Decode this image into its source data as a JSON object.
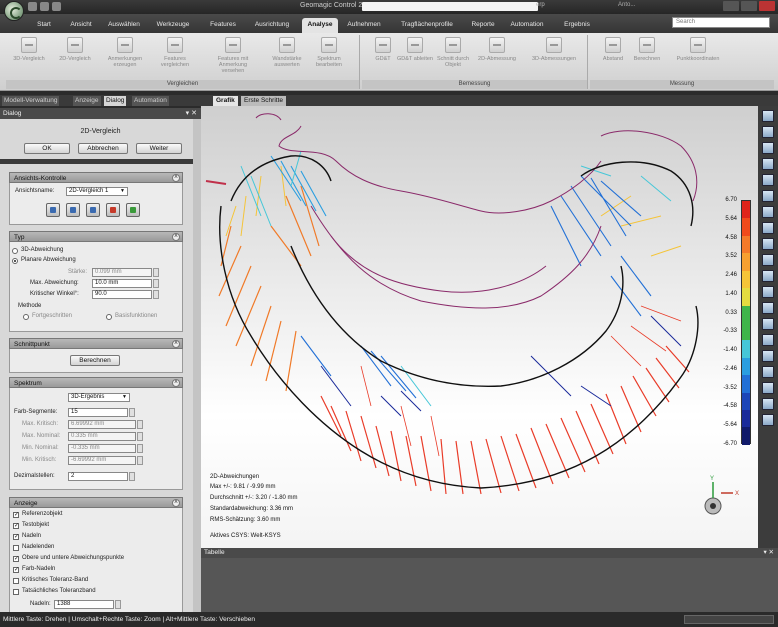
{
  "window": {
    "title": "Geomagic Control 2014",
    "title_path_tail": "erp",
    "user": "Anto..."
  },
  "ribbon_tabs": [
    "Start",
    "Ansicht",
    "Auswählen",
    "Werkzeuge",
    "Features",
    "Ausrichtung",
    "Analyse",
    "Aufnehmen",
    "Tragflächenprofile",
    "Reporte",
    "Automation",
    "Ergebnis"
  ],
  "search_placeholder": "Search",
  "ribbon_groups": {
    "vergleichen": {
      "label": "Vergleichen",
      "buttons": [
        "3D-Vergleich",
        "2D-Vergleich",
        "Anmerkungen erzeugen",
        "Features vergleichen",
        "Features mit Anmerkung versehen",
        "Wandstärke auswerten",
        "Spektrum bearbeiten"
      ]
    },
    "bemessung": {
      "label": "Bemessung",
      "buttons": [
        "GD&T",
        "GD&T ableiten",
        "Schnitt durch Objekt",
        "2D-Abmessung",
        "3D-Abmessungen"
      ]
    },
    "messung": {
      "label": "Messung",
      "buttons": [
        "Abstand",
        "Berechnen",
        "Punktkoordinaten"
      ]
    }
  },
  "panel_tabs": [
    "Modell-Verwaltung",
    "Anzeige",
    "Dialog",
    "Automation"
  ],
  "dialog": {
    "header": "Dialog",
    "title": "2D-Vergleich",
    "ok": "OK",
    "cancel": "Abbrechen",
    "next": "Weiter",
    "ansichts_kontrolle": {
      "header": "Ansichts-Kontrolle",
      "ansichtsname_label": "Ansichtsname:",
      "ansichtsname_value": "2D-Vergleich 1"
    },
    "typ": {
      "header": "Typ",
      "option_3d": "3D-Abweichung",
      "option_planar": "Planare Abweichung",
      "staerke_label": "Stärke:",
      "staerke_value": "0.099 mm",
      "max_abw_label": "Max. Abweichung:",
      "max_abw_value": "10.0 mm",
      "winkel_label": "Kritischer Winkel°:",
      "winkel_value": "90.0",
      "methode_label": "Methode",
      "methode_opt1": "Fortgeschritten",
      "methode_opt2": "Basisfunktionen"
    },
    "schnittpunkt": {
      "header": "Schnittpunkt",
      "button": "Berechnen"
    },
    "spektrum": {
      "header": "Spektrum",
      "mode": "3D-Ergebnis",
      "farb_label": "Farb-Segmente:",
      "farb_value": "15",
      "max_krit_label": "Max. Kritisch:",
      "max_krit_value": "6.69992 mm",
      "max_nom_label": "Max. Nominal:",
      "max_nom_value": "0.335 mm",
      "min_nom_label": "Min. Nominal:",
      "min_nom_value": "-0.335 mm",
      "min_krit_label": "Min. Kritisch:",
      "min_krit_value": "-6.69992 mm",
      "dezimal_label": "Dezimalstellen:",
      "dezimal_value": "2"
    },
    "anzeige": {
      "header": "Anzeige",
      "items": [
        {
          "label": "Referenzobjekt",
          "checked": true
        },
        {
          "label": "Testobjekt",
          "checked": true
        },
        {
          "label": "Nadeln",
          "checked": true
        },
        {
          "label": "Nadelenden",
          "checked": false
        },
        {
          "label": "Obere und untere Abweichungspunkte",
          "checked": true
        },
        {
          "label": "Farb-Nadeln",
          "checked": true
        },
        {
          "label": "Kritisches Toleranz-Band",
          "checked": false
        },
        {
          "label": "Tatsächliches Toleranzband",
          "checked": false
        }
      ],
      "nadeln_label": "Nadeln:",
      "nadeln_value": "1388"
    }
  },
  "view_tabs": [
    "Grafik",
    "Erste Schritte"
  ],
  "color_scale": {
    "labels": [
      "6.70",
      "5.64",
      "4.58",
      "3.52",
      "2.46",
      "1.40",
      "0.33",
      "-0.33",
      "-1.40",
      "-2.46",
      "-3.52",
      "-4.58",
      "-5.64",
      "-6.70"
    ],
    "colors": [
      "#e0241b",
      "#f04a1c",
      "#f47a2a",
      "#f7a030",
      "#f5c437",
      "#e4dc40",
      "#3fb54a",
      "#3fb54a",
      "#46c7d8",
      "#2a9ee0",
      "#2270d6",
      "#1c46b8",
      "#1a2a9a",
      "#111a6a"
    ]
  },
  "deviation_info": {
    "title": "2D-Abweichungen",
    "max": "Max +/-: 9.81 / -9.99 mm",
    "avg": "Durchschnitt +/-: 3.20 / -1.80 mm",
    "std": "Standardabweichung: 3.36 mm",
    "rms": "RMS-Schätzung: 3.60 mm",
    "csys": "Aktives CSYS: Welt-KSYS"
  },
  "axis": {
    "x": "X",
    "y": "Y"
  },
  "table_header": "Tabelle",
  "status_text": "Mittlere Taste: Drehen | Umschalt+Rechte Taste: Zoom | Alt+Mittlere Taste: Verschieben"
}
